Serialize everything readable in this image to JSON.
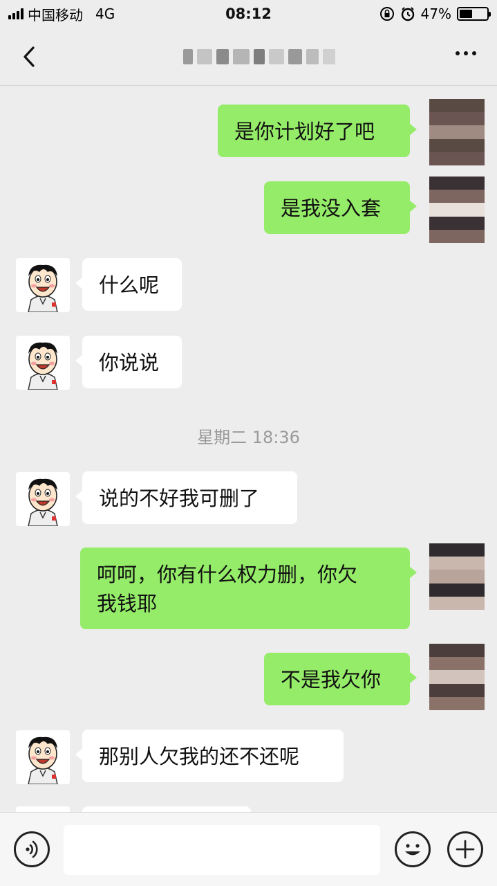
{
  "status_bar": {
    "carrier": "中国移动",
    "network": "4G",
    "time": "08:12",
    "battery_percent": "47%",
    "battery_level": 0.47,
    "icons": [
      "signal-icon",
      "orientation-lock-icon",
      "alarm-icon",
      "battery-icon"
    ]
  },
  "nav": {
    "back_icon": "chevron-left-icon",
    "more_icon": "more-dots-icon"
  },
  "messages": [
    {
      "side": "out",
      "text": "是你计划好了吧"
    },
    {
      "side": "out",
      "text": "是我没入套"
    },
    {
      "side": "in",
      "text": "什么呢"
    },
    {
      "side": "in",
      "text": "你说说"
    },
    {
      "side": "in",
      "text": "说的不好我可删了"
    },
    {
      "side": "out",
      "lines": [
        "呵呵，你有什么权力删，你欠",
        "我钱耶"
      ]
    },
    {
      "side": "out",
      "text": "不是我欠你"
    },
    {
      "side": "in",
      "text": "那别人欠我的还不还呢"
    }
  ],
  "timestamp": "星期二 18:36",
  "input_bar": {
    "voice_icon": "voice-icon",
    "emoji_icon": "emoji-icon",
    "plus_icon": "plus-icon",
    "placeholder": ""
  },
  "colors": {
    "bubble_out": "#95ec69",
    "bubble_in": "#ffffff",
    "background": "#ededed"
  }
}
